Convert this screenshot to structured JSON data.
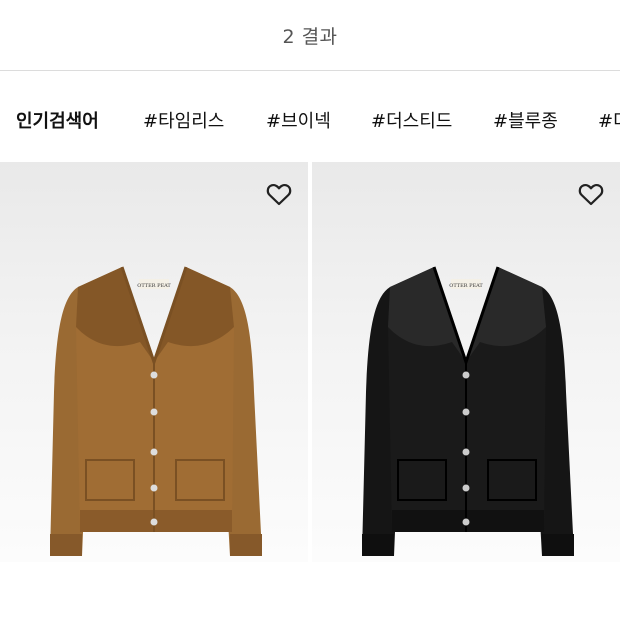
{
  "results": {
    "count_text": "2 결과"
  },
  "popular_searches": {
    "title": "인기검색어",
    "keywords": [
      "#타임리스",
      "#브이넥",
      "#더스티드",
      "#블루종",
      "#더"
    ]
  },
  "products": [
    {
      "color": "#9a6a33",
      "heart_icon": "heart-outline-icon",
      "tag_text": "OTTER PEAT"
    },
    {
      "color": "#151515",
      "heart_icon": "heart-outline-icon",
      "tag_text": "OTTER PEAT"
    }
  ]
}
